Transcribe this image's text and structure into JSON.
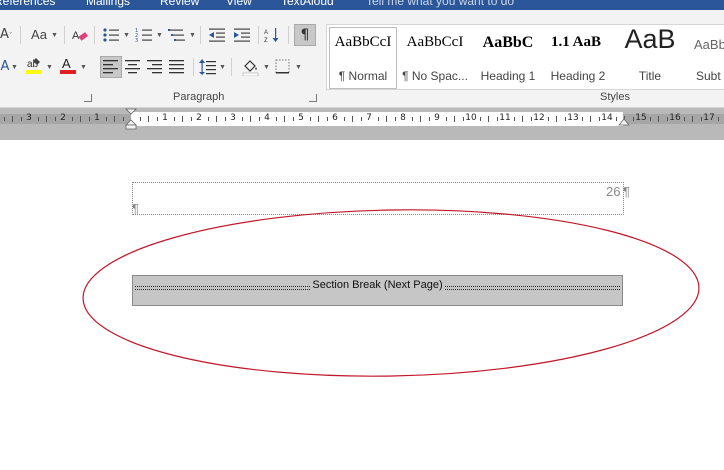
{
  "tabs": {
    "references": "References",
    "mailings": "Mailings",
    "review": "Review",
    "view": "View",
    "textaloud": "TextAloud",
    "tell_me": "Tell me what you want to do"
  },
  "ribbon": {
    "paragraph_label": "Paragraph",
    "styles_label": "Styles",
    "font_case_label": "Aa",
    "styles": [
      {
        "preview": "AaBbCcI",
        "name": "¶ Normal"
      },
      {
        "preview": "AaBbCcI",
        "name": "¶ No Spac..."
      },
      {
        "preview": "AaBbC",
        "name": "Heading 1"
      },
      {
        "preview": "1.1  AaB",
        "name": "Heading 2"
      },
      {
        "preview": "AaB",
        "name": "Title"
      },
      {
        "preview": "AaBbC",
        "name": "Subt"
      }
    ]
  },
  "ruler": {
    "labels": [
      "3",
      "2",
      "1",
      "1",
      "2",
      "3",
      "4",
      "5",
      "6",
      "7",
      "8",
      "9",
      "10",
      "11",
      "12",
      "13",
      "14",
      "15",
      "16",
      "17"
    ]
  },
  "document": {
    "page_number": "26",
    "pilcrow": "¶",
    "section_break": "Section Break (Next Page)"
  },
  "colors": {
    "tab_bar": "#2b579a",
    "ribbon_bg": "#f3f3f3",
    "ruler_bg": "#b9b9b9",
    "section_break_bg": "#c6c6c6",
    "annotation": "#c0182a"
  }
}
